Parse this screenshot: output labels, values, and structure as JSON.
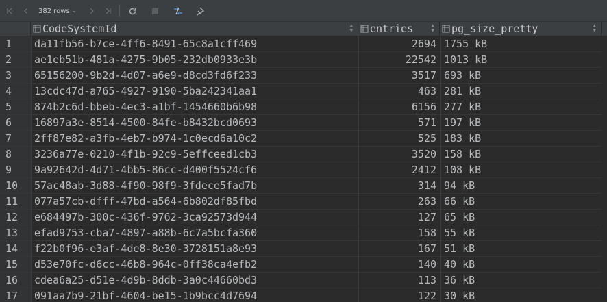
{
  "toolbar": {
    "rows_label": "382 rows",
    "buttons": [
      {
        "name": "first-page-icon",
        "glyph": "first"
      },
      {
        "name": "prev-page-icon",
        "glyph": "prev"
      },
      {
        "name": "next-page-icon",
        "glyph": "next"
      },
      {
        "name": "last-page-icon",
        "glyph": "last"
      },
      {
        "name": "refresh-icon",
        "glyph": "refresh"
      },
      {
        "name": "stop-icon",
        "glyph": "stop"
      },
      {
        "name": "compare-icon",
        "glyph": "compare"
      },
      {
        "name": "pin-icon",
        "glyph": "pin"
      }
    ]
  },
  "columns": [
    "CodeSystemId",
    "entries",
    "pg_size_pretty"
  ],
  "rows": [
    {
      "n": "1",
      "id": "da11fb56-b7ce-4ff6-8491-65c8a1cff469",
      "entries": "2694",
      "size": "1755 kB"
    },
    {
      "n": "2",
      "id": "ae1eb51b-481a-4275-9b05-232db0933e3b",
      "entries": "22542",
      "size": "1013 kB"
    },
    {
      "n": "3",
      "id": "65156200-9b2d-4d07-a6e9-d8cd3fd6f233",
      "entries": "3517",
      "size": "693 kB"
    },
    {
      "n": "4",
      "id": "13cdc47d-a765-4927-9190-5ba242341aa1",
      "entries": "463",
      "size": "281 kB"
    },
    {
      "n": "5",
      "id": "874b2c6d-bbeb-4ec3-a1bf-1454660b6b98",
      "entries": "6156",
      "size": "277 kB"
    },
    {
      "n": "6",
      "id": "16897a3e-8514-4500-84fe-b8432bcd0693",
      "entries": "571",
      "size": "197 kB"
    },
    {
      "n": "7",
      "id": "2ff87e82-a3fb-4eb7-b974-1c0ecd6a10c2",
      "entries": "525",
      "size": "183 kB"
    },
    {
      "n": "8",
      "id": "3236a77e-0210-4f1b-92c9-5effceed1cb3",
      "entries": "3520",
      "size": "158 kB"
    },
    {
      "n": "9",
      "id": "9a92642d-4d71-4bb5-86cc-d400f5524cf6",
      "entries": "2412",
      "size": "108 kB"
    },
    {
      "n": "10",
      "id": "57ac48ab-3d88-4f90-98f9-3fdece5fad7b",
      "entries": "314",
      "size": "94 kB"
    },
    {
      "n": "11",
      "id": "077a57cb-dfff-47bd-a564-6b802df85fbd",
      "entries": "263",
      "size": "66 kB"
    },
    {
      "n": "12",
      "id": "e684497b-300c-436f-9762-3ca92573d944",
      "entries": "127",
      "size": "65 kB"
    },
    {
      "n": "13",
      "id": "efad9753-cba7-4897-a88b-6c7a5bcfa360",
      "entries": "158",
      "size": "55 kB"
    },
    {
      "n": "14",
      "id": "f22b0f96-e3af-4de8-8e30-3728151a8e93",
      "entries": "167",
      "size": "51 kB"
    },
    {
      "n": "15",
      "id": "d53e70fc-d6cc-46b8-964c-0ff38ca4efb2",
      "entries": "140",
      "size": "40 kB"
    },
    {
      "n": "16",
      "id": "cdea6a25-d51e-4d9b-8ddb-3a0c44660bd3",
      "entries": "113",
      "size": "36 kB"
    },
    {
      "n": "17",
      "id": "091aa7b9-21bf-4604-be15-1b9bcc4d7694",
      "entries": "122",
      "size": "30 kB"
    }
  ],
  "colors": {
    "background": "#2b2b2b",
    "toolbar": "#3c3f41",
    "text": "#b9bcbf",
    "accent": "#4a88c7"
  }
}
